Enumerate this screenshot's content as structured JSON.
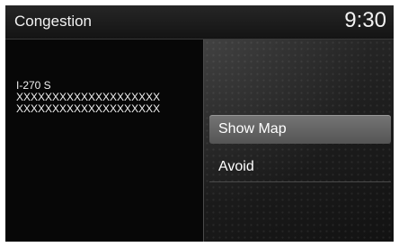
{
  "header": {
    "title": "Congestion",
    "time": "9:30"
  },
  "info": {
    "road": "I-270 S",
    "line1": "XXXXXXXXXXXXXXXXXXXX",
    "line2": "XXXXXXXXXXXXXXXXXXXX"
  },
  "menu": {
    "items": [
      {
        "label": "Show Map",
        "selected": true
      },
      {
        "label": "Avoid",
        "selected": false
      }
    ]
  }
}
